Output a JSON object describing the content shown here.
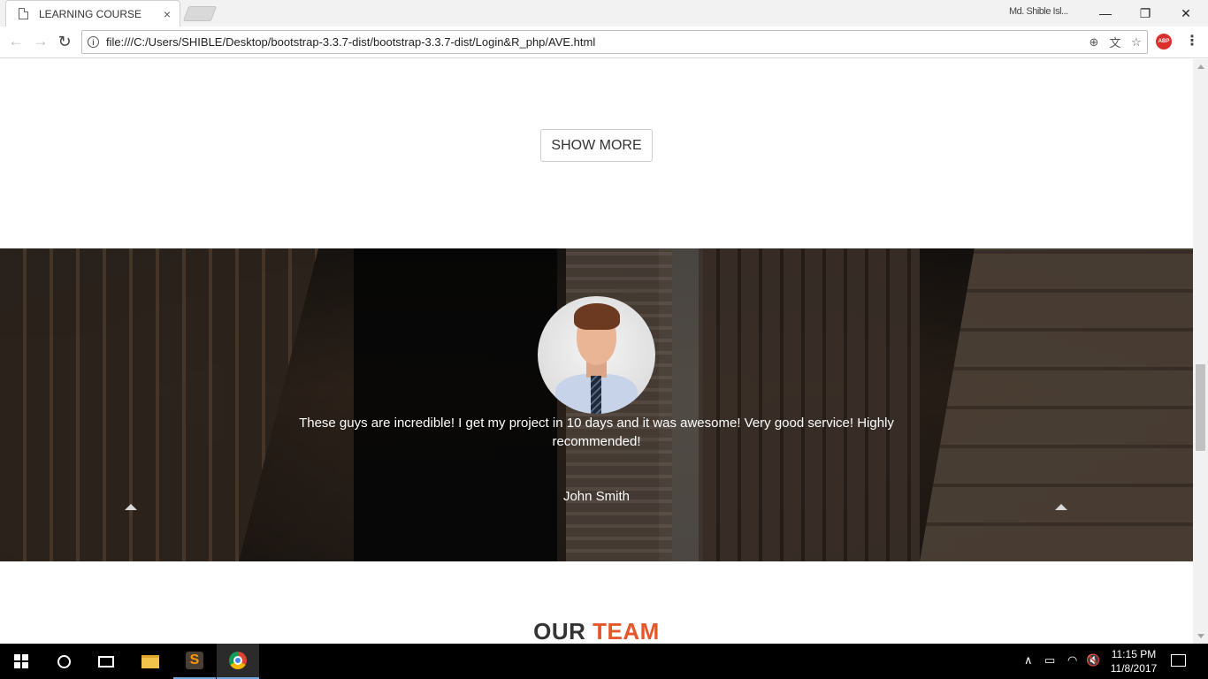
{
  "browser": {
    "tab_title": "LEARNING COURSE",
    "tab_close": "×",
    "profile_name": "Md. Shible Isl...",
    "url": "file:///C:/Users/SHIBLE/Desktop/bootstrap-3.3.7-dist/bootstrap-3.3.7-dist/Login&R_php/AVE.html",
    "window_controls": {
      "minimize": "—",
      "restore": "❐",
      "close": "✕"
    },
    "nav": {
      "back": "←",
      "forward": "→",
      "reload": "↻"
    },
    "omnibox_icons": {
      "zoom": "⊕",
      "translate": "文",
      "bookmark": "☆"
    },
    "extension_abp": "ABP",
    "menu": "⋮"
  },
  "page": {
    "show_more_label": "SHOW MORE",
    "testimonial": {
      "quote": "These guys are incredible! I get my project in 10 days and it was awesome! Very good service! Highly recommended!",
      "author": "John Smith"
    },
    "team_heading": {
      "part1": "OUR",
      "part2": "TEAM"
    }
  },
  "taskbar": {
    "sublime_glyph": "S",
    "tray": {
      "up": "∧",
      "battery": "▭",
      "wifi": "◠",
      "volume": "🔇"
    },
    "clock": {
      "time": "11:15 PM",
      "date": "11/8/2017"
    }
  },
  "colors": {
    "accent": "#e5562b",
    "taskbar": "#000000"
  }
}
